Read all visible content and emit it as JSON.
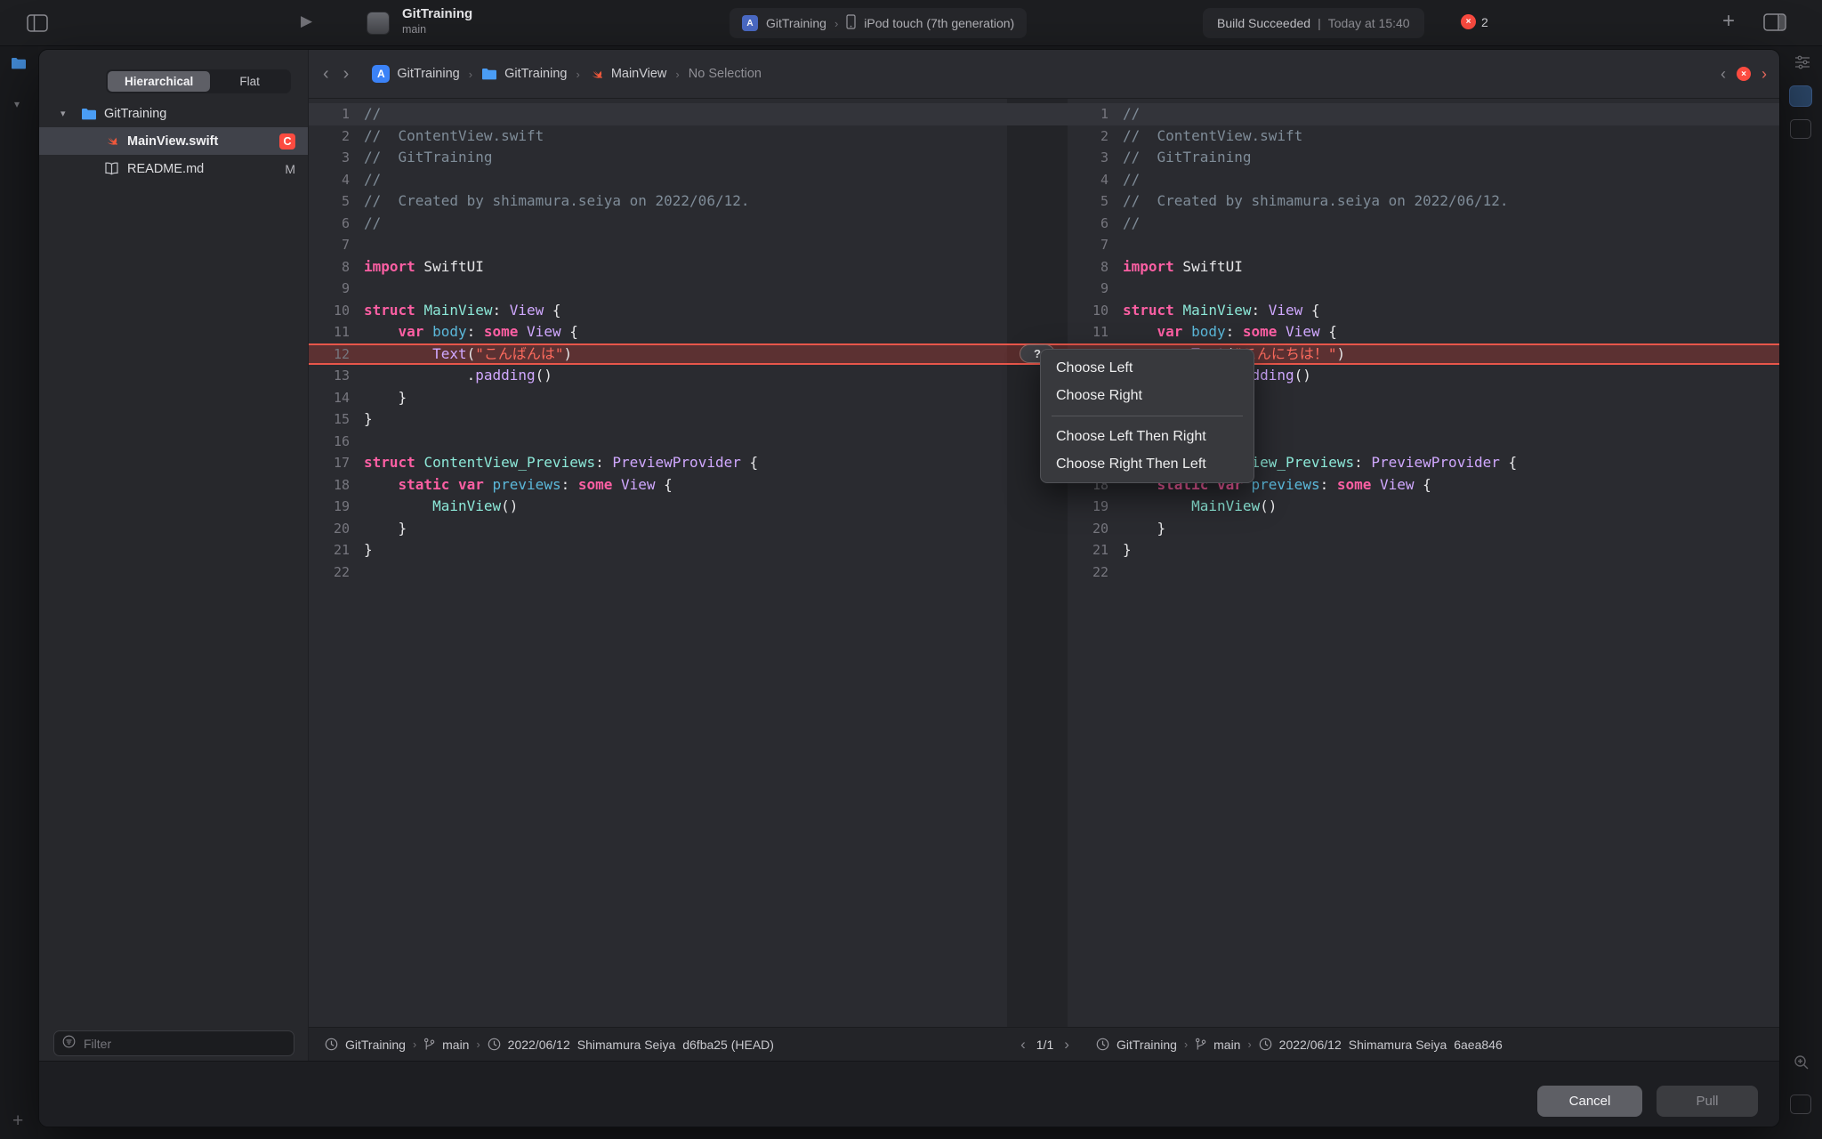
{
  "icons": {
    "crumb_sep": "›",
    "back_chevron": "‹",
    "forward_chevron": "›",
    "disclosure": "▾",
    "error_x": "×",
    "plus": "+",
    "play": "▶",
    "pager_left": "‹",
    "pager_right": "›"
  },
  "toolbar": {
    "scheme_name": "GitTraining",
    "scheme_subtitle": "main",
    "run_destination": {
      "project": "GitTraining",
      "device": "iPod touch (7th generation)"
    },
    "status": {
      "build": "Build Succeeded",
      "sep": "|",
      "time": "Today at 15:40"
    },
    "error_count": "2"
  },
  "sheet": {
    "sidebar": {
      "segments": [
        {
          "label": "Hierarchical",
          "selected": true
        },
        {
          "label": "Flat",
          "selected": false
        }
      ],
      "tree": [
        {
          "label": "GitTraining",
          "icon": "folder-icon",
          "level": 0,
          "disclosure": true
        },
        {
          "label": "MainView.swift",
          "icon": "swift-icon",
          "level": 1,
          "selected": true,
          "badge": "C",
          "badge_style": "conflict"
        },
        {
          "label": "README.md",
          "icon": "book-icon",
          "level": 1,
          "badge": "M",
          "badge_style": "plain"
        }
      ],
      "filter_placeholder": "Filter"
    },
    "jumpbar": {
      "crumbs": [
        {
          "label": "GitTraining",
          "icon": "app-icon"
        },
        {
          "label": "GitTraining",
          "icon": "folder-icon"
        },
        {
          "label": "MainView",
          "icon": "swift-icon"
        },
        {
          "label": "No Selection",
          "dim": true
        }
      ]
    },
    "editors": {
      "conflict_line": 12,
      "conflict_marker": "?",
      "left_lines": [
        [
          [
            "cm",
            "//"
          ]
        ],
        [
          [
            "cm",
            "//  ContentView.swift"
          ]
        ],
        [
          [
            "cm",
            "//  GitTraining"
          ]
        ],
        [
          [
            "cm",
            "//"
          ]
        ],
        [
          [
            "cm",
            "//  Created by shimamura.seiya on 2022/06/12."
          ]
        ],
        [
          [
            "cm",
            "//"
          ]
        ],
        [],
        [
          [
            "kw",
            "import"
          ],
          [
            "pl",
            " SwiftUI"
          ]
        ],
        [],
        [
          [
            "kw",
            "struct"
          ],
          [
            "pl",
            " "
          ],
          [
            "pt",
            "MainView"
          ],
          [
            "pl",
            ": "
          ],
          [
            "ty",
            "View"
          ],
          [
            "pl",
            " {"
          ]
        ],
        [
          [
            "pl",
            "    "
          ],
          [
            "kw",
            "var"
          ],
          [
            "pl",
            " "
          ],
          [
            "pr",
            "body"
          ],
          [
            "pl",
            ": "
          ],
          [
            "kw",
            "some"
          ],
          [
            "pl",
            " "
          ],
          [
            "ty",
            "View"
          ],
          [
            "pl",
            " {"
          ]
        ],
        [
          [
            "pl",
            "        "
          ],
          [
            "ty",
            "Text"
          ],
          [
            "pl",
            "("
          ],
          [
            "st",
            "\"こんばんは\""
          ],
          [
            "pl",
            ")"
          ]
        ],
        [
          [
            "pl",
            "            ."
          ],
          [
            "ty",
            "padding"
          ],
          [
            "pl",
            "()"
          ]
        ],
        [
          [
            "pl",
            "    }"
          ]
        ],
        [
          [
            "pl",
            "}"
          ]
        ],
        [],
        [
          [
            "kw",
            "struct"
          ],
          [
            "pl",
            " "
          ],
          [
            "pt",
            "ContentView_Previews"
          ],
          [
            "pl",
            ": "
          ],
          [
            "ty",
            "PreviewProvider"
          ],
          [
            "pl",
            " {"
          ]
        ],
        [
          [
            "pl",
            "    "
          ],
          [
            "kw",
            "static"
          ],
          [
            "pl",
            " "
          ],
          [
            "kw",
            "var"
          ],
          [
            "pl",
            " "
          ],
          [
            "pr",
            "previews"
          ],
          [
            "pl",
            ": "
          ],
          [
            "kw",
            "some"
          ],
          [
            "pl",
            " "
          ],
          [
            "ty",
            "View"
          ],
          [
            "pl",
            " {"
          ]
        ],
        [
          [
            "pl",
            "        "
          ],
          [
            "pt",
            "MainView"
          ],
          [
            "pl",
            "()"
          ]
        ],
        [
          [
            "pl",
            "    }"
          ]
        ],
        [
          [
            "pl",
            "}"
          ]
        ],
        []
      ],
      "right_lines": [
        [
          [
            "cm",
            "//"
          ]
        ],
        [
          [
            "cm",
            "//  ContentView.swift"
          ]
        ],
        [
          [
            "cm",
            "//  GitTraining"
          ]
        ],
        [
          [
            "cm",
            "//"
          ]
        ],
        [
          [
            "cm",
            "//  Created by shimamura.seiya on 2022/06/12."
          ]
        ],
        [
          [
            "cm",
            "//"
          ]
        ],
        [],
        [
          [
            "kw",
            "import"
          ],
          [
            "pl",
            " SwiftUI"
          ]
        ],
        [],
        [
          [
            "kw",
            "struct"
          ],
          [
            "pl",
            " "
          ],
          [
            "pt",
            "MainView"
          ],
          [
            "pl",
            ": "
          ],
          [
            "ty",
            "View"
          ],
          [
            "pl",
            " {"
          ]
        ],
        [
          [
            "pl",
            "    "
          ],
          [
            "kw",
            "var"
          ],
          [
            "pl",
            " "
          ],
          [
            "pr",
            "body"
          ],
          [
            "pl",
            ": "
          ],
          [
            "kw",
            "some"
          ],
          [
            "pl",
            " "
          ],
          [
            "ty",
            "View"
          ],
          [
            "pl",
            " {"
          ]
        ],
        [
          [
            "pl",
            "        "
          ],
          [
            "ty",
            "Text"
          ],
          [
            "pl",
            "("
          ],
          [
            "st",
            "\"こんにちは！\""
          ],
          [
            "pl",
            ")"
          ]
        ],
        [
          [
            "pl",
            "            ."
          ],
          [
            "ty",
            "padding"
          ],
          [
            "pl",
            "()"
          ]
        ],
        [
          [
            "pl",
            "    }"
          ]
        ],
        [
          [
            "pl",
            "}"
          ]
        ],
        [],
        [
          [
            "kw",
            "struct"
          ],
          [
            "pl",
            " "
          ],
          [
            "pt",
            "ContentView_Previews"
          ],
          [
            "pl",
            ": "
          ],
          [
            "ty",
            "PreviewProvider"
          ],
          [
            "pl",
            " {"
          ]
        ],
        [
          [
            "pl",
            "    "
          ],
          [
            "kw",
            "static"
          ],
          [
            "pl",
            " "
          ],
          [
            "kw",
            "var"
          ],
          [
            "pl",
            " "
          ],
          [
            "pr",
            "previews"
          ],
          [
            "pl",
            ": "
          ],
          [
            "kw",
            "some"
          ],
          [
            "pl",
            " "
          ],
          [
            "ty",
            "View"
          ],
          [
            "pl",
            " {"
          ]
        ],
        [
          [
            "pl",
            "        "
          ],
          [
            "pt",
            "MainView"
          ],
          [
            "pl",
            "()"
          ]
        ],
        [
          [
            "pl",
            "    }"
          ]
        ],
        [
          [
            "pl",
            "}"
          ]
        ],
        []
      ]
    },
    "context_menu": {
      "items": [
        {
          "label": "Choose Left"
        },
        {
          "label": "Choose Right"
        },
        {
          "separator": true
        },
        {
          "label": "Choose Left Then Right"
        },
        {
          "label": "Choose Right Then Left"
        }
      ]
    },
    "bottombar": {
      "left": {
        "project": "GitTraining",
        "branch": "main",
        "date": "2022/06/12",
        "author": "Shimamura Seiya",
        "hash": "d6fba25 (HEAD)"
      },
      "pager": "1/1",
      "right": {
        "project": "GitTraining",
        "branch": "main",
        "date": "2022/06/12",
        "author": "Shimamura Seiya",
        "hash": "6aea846"
      }
    },
    "footer": {
      "cancel": "Cancel",
      "pull": "Pull"
    }
  }
}
